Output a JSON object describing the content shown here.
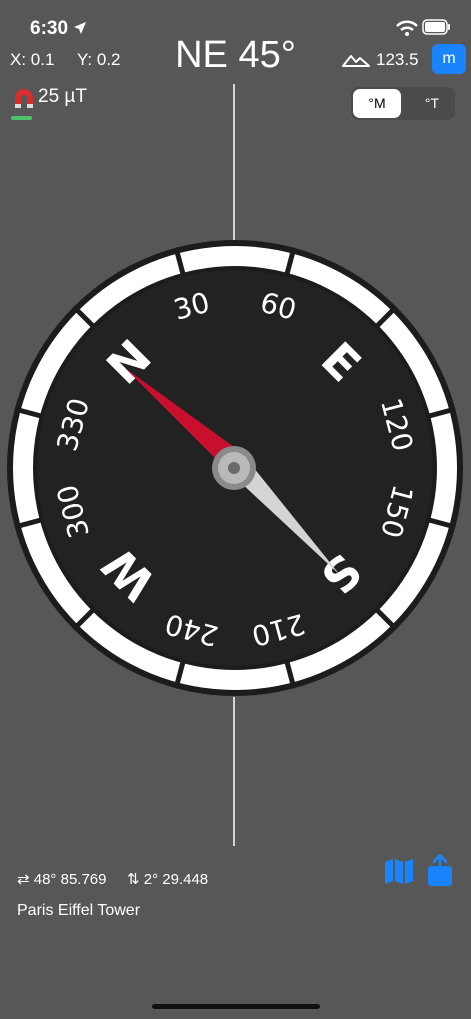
{
  "status": {
    "time": "6:30"
  },
  "sensor": {
    "x_label": "X:",
    "x_value": "0.1",
    "y_label": "Y:",
    "y_value": "0.2"
  },
  "heading": {
    "text": "NE 45°"
  },
  "altitude": {
    "value": "123.5",
    "unit_button": "m"
  },
  "magnetic": {
    "text": "25 µT"
  },
  "reference_toggle": {
    "magnetic": "°M",
    "true_north": "°T"
  },
  "compass": {
    "cardinals": [
      "N",
      "E",
      "S",
      "W"
    ],
    "degrees": [
      "30",
      "60",
      "120",
      "150",
      "210",
      "240",
      "300",
      "330"
    ]
  },
  "location": {
    "longitude": "48° 85.769",
    "latitude": "2° 29.448",
    "name": "Paris Eiffel Tower"
  },
  "colors": {
    "accent": "#1a84ff",
    "background": "#575757",
    "needle_north": "#c8102e",
    "strength": "#4cc46a"
  }
}
